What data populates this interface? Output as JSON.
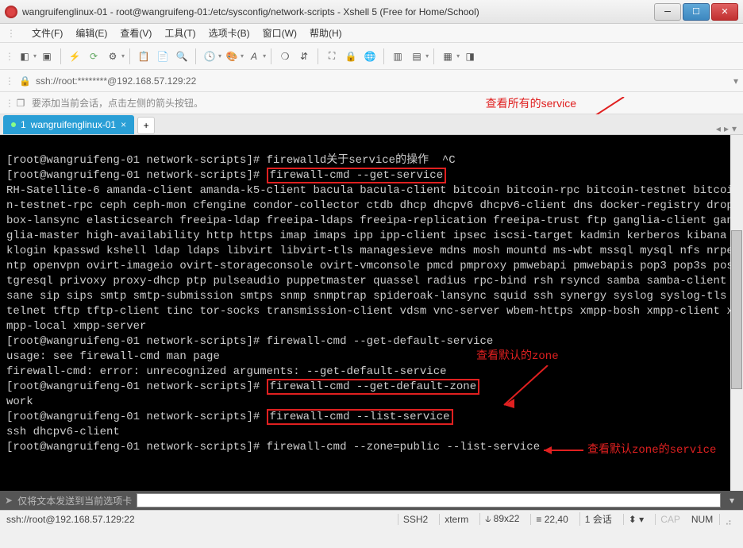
{
  "titlebar": {
    "title": "wangruifenglinux-01 - root@wangruifeng-01:/etc/sysconfig/network-scripts - Xshell 5 (Free for Home/School)"
  },
  "menubar": {
    "items": [
      "文件(F)",
      "编辑(E)",
      "查看(V)",
      "工具(T)",
      "选项卡(B)",
      "窗口(W)",
      "帮助(H)"
    ]
  },
  "addressbar": {
    "url": "ssh://root:********@192.168.57.129:22"
  },
  "hintbar": {
    "text": "要添加当前会话，点击左侧的箭头按钮。"
  },
  "annotations": {
    "a1": "查看所有的service",
    "a2": "查看默认的zone",
    "a3": "查看默认zone的service"
  },
  "tab": {
    "index": "1",
    "label": "wangruifenglinux-01"
  },
  "terminal": {
    "prompt": "[root@wangruifeng-01 network-scripts]# ",
    "l1_cmd": "firewalld关于service的操作  ^C",
    "l2_cmd": "firewall-cmd --get-service",
    "services_block": "RH-Satellite-6 amanda-client amanda-k5-client bacula bacula-client bitcoin bitcoin-rpc bitcoin-testnet bitcoin-testnet-rpc ceph ceph-mon cfengine condor-collector ctdb dhcp dhcpv6 dhcpv6-client dns docker-registry dropbox-lansync elasticsearch freeipa-ldap freeipa-ldaps freeipa-replication freeipa-trust ftp ganglia-client ganglia-master high-availability http https imap imaps ipp ipp-client ipsec iscsi-target kadmin kerberos kibana klogin kpasswd kshell ldap ldaps libvirt libvirt-tls managesieve mdns mosh mountd ms-wbt mssql mysql nfs nrpe ntp openvpn ovirt-imageio ovirt-storageconsole ovirt-vmconsole pmcd pmproxy pmwebapi pmwebapis pop3 pop3s postgresql privoxy proxy-dhcp ptp pulseaudio puppetmaster quassel radius rpc-bind rsh rsyncd samba samba-client sane sip sips smtp smtp-submission smtps snmp snmptrap spideroak-lansync squid ssh synergy syslog syslog-tls telnet tftp tftp-client tinc tor-socks transmission-client vdsm vnc-server wbem-https xmpp-bosh xmpp-client xmpp-local xmpp-server",
    "l3_cmd": "firewall-cmd --get-default-service",
    "l3_out1": "usage: see firewall-cmd man page",
    "l3_out2": "firewall-cmd: error: unrecognized arguments: --get-default-service",
    "l4_cmd": "firewall-cmd --get-default-zone",
    "l4_out": "work",
    "l5_cmd": "firewall-cmd --list-service",
    "l5_out": "ssh dhcpv6-client",
    "l6_cmd": "firewall-cmd --zone=public --list-service"
  },
  "sendbar": {
    "placeholder": "仅将文本发送到当前选项卡"
  },
  "statusbar": {
    "left": "ssh://root@192.168.57.129:22",
    "ssh2": "SSH2",
    "term": "xterm",
    "size": "89x22",
    "pos": "22,40",
    "sess": "1 会话",
    "cap": "CAP",
    "num": "NUM"
  }
}
